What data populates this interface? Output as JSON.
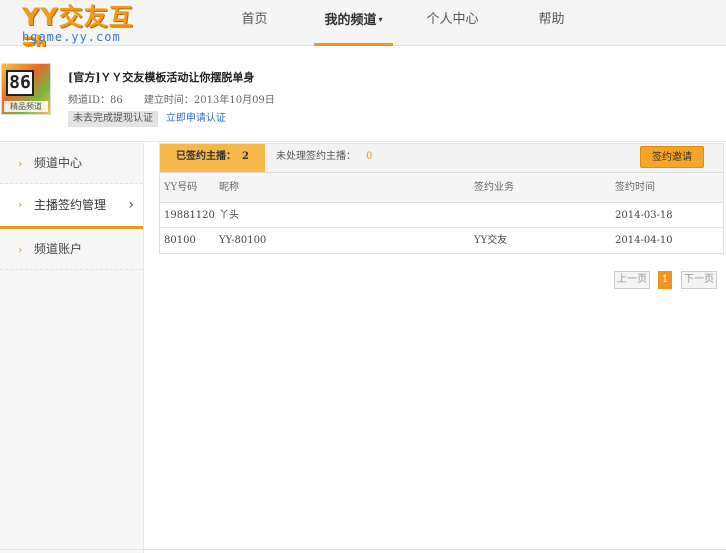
{
  "header": {
    "logo_main": "YY交友互动",
    "logo_sub": "hgame.yy.com",
    "nav": [
      {
        "label": "首页"
      },
      {
        "label": "我的频道",
        "caret": "▾"
      },
      {
        "label": "个人中心"
      },
      {
        "label": "帮助"
      }
    ]
  },
  "channel": {
    "avatar_number": "86",
    "avatar_tag": "精品频道",
    "title": "[官方]ＹＹ交友模板活动让你摆脱单身",
    "id_label": "频道ID：86",
    "created_label": "建立时间：2013年10月09日",
    "cert_status": "未去完成提现认证",
    "cert_link": "立即申请认证"
  },
  "sidebar": {
    "items": [
      {
        "label": "频道中心"
      },
      {
        "label": "主播签约管理"
      },
      {
        "label": "频道账户"
      }
    ]
  },
  "main": {
    "tabs": [
      {
        "label": "已签约主播：",
        "count": "2"
      },
      {
        "label": "未处理签约主播：",
        "count": "0"
      }
    ],
    "invite_button": "签约邀请",
    "table": {
      "headers": [
        "YY号码",
        "昵称",
        "签约业务",
        "签约时间"
      ],
      "rows": [
        [
          "19881120",
          "丫头",
          "",
          "2014-03-18"
        ],
        [
          "80100",
          "YY-80100",
          "YY交友",
          "2014-04-10"
        ]
      ]
    },
    "pager": {
      "prev": "上一页",
      "current": "1",
      "next": "下一页"
    }
  },
  "colors": {
    "accent": "#f29421",
    "link": "#2e6fc6"
  }
}
